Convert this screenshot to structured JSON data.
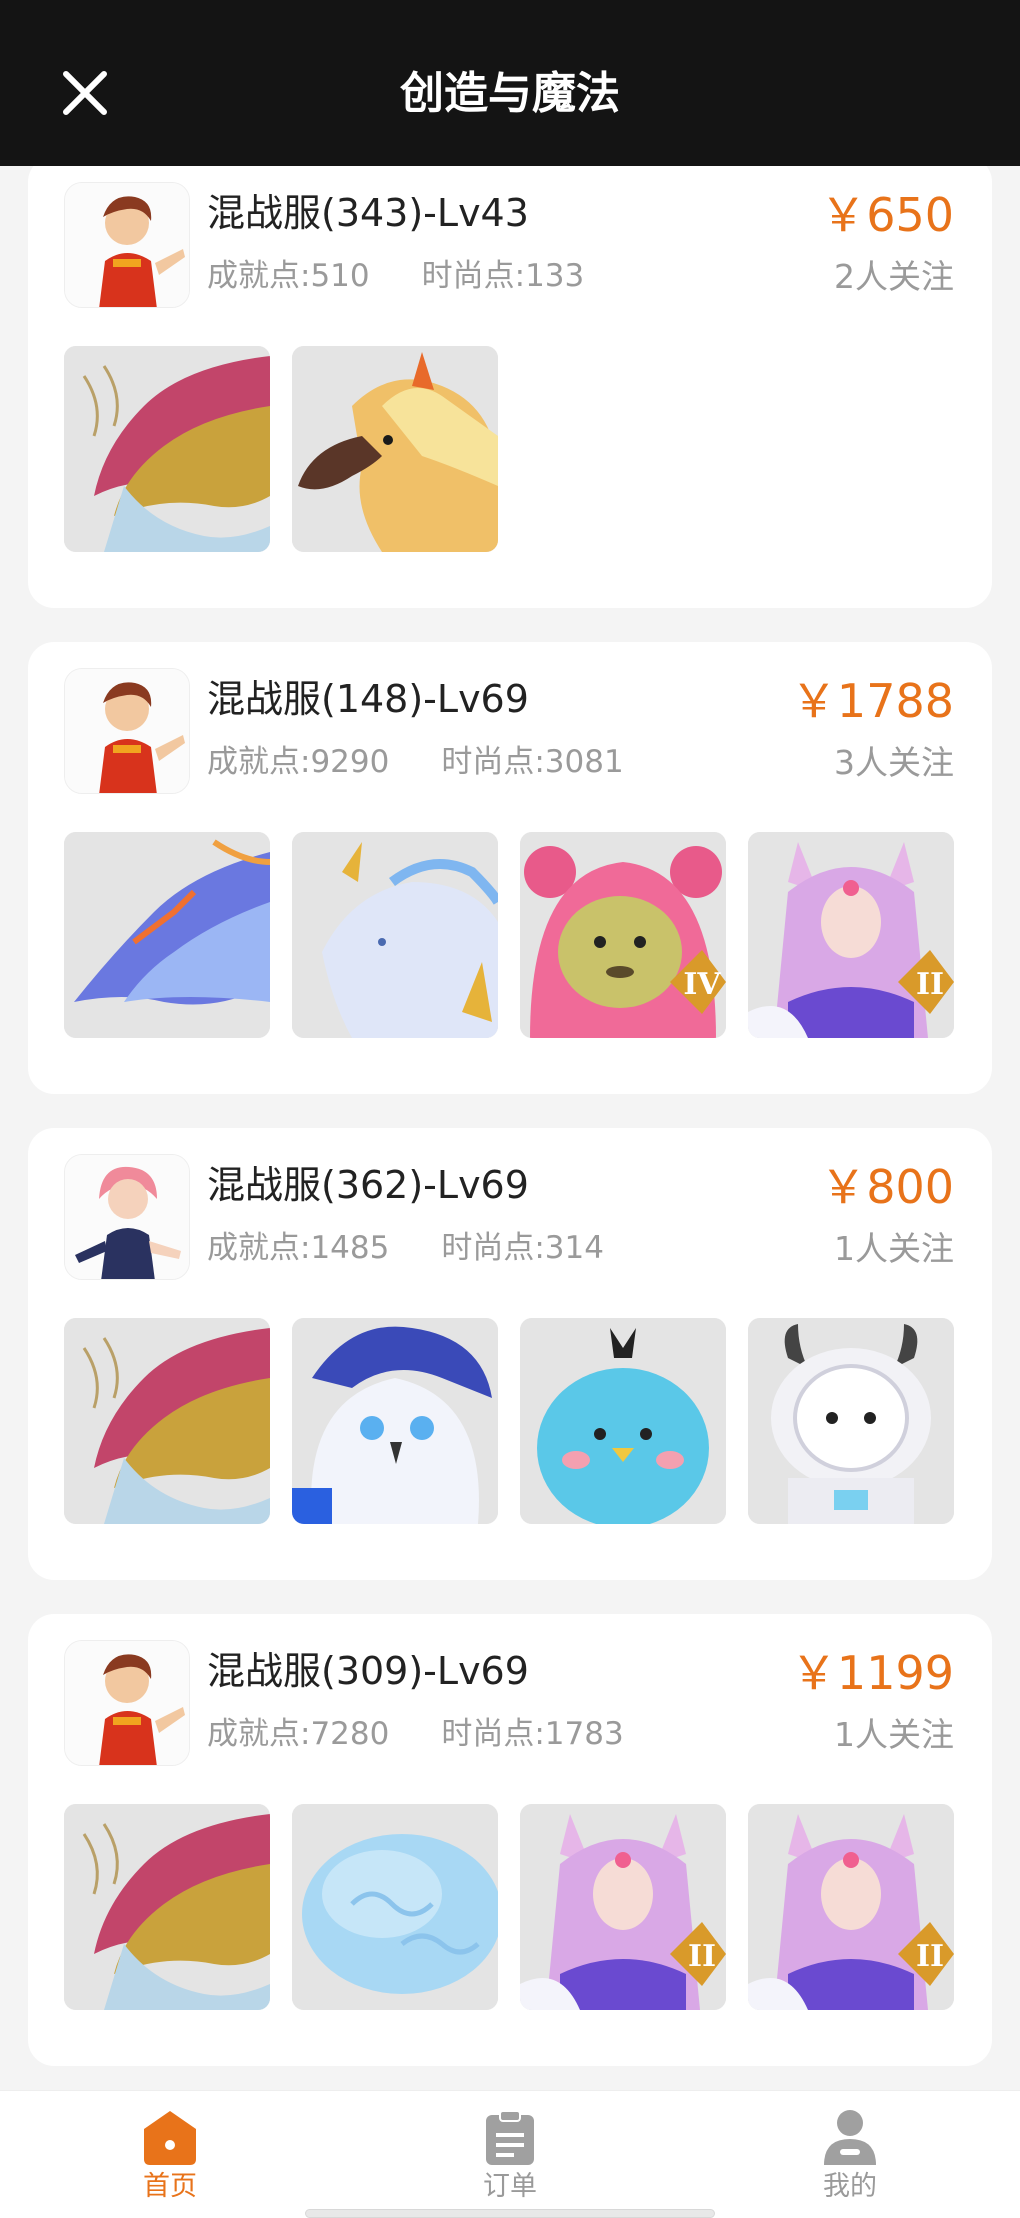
{
  "header": {
    "title": "创造与魔法"
  },
  "listings": [
    {
      "name": "混战服(343)-Lv43",
      "achievement": "成就点:510",
      "fashion": "时尚点:133",
      "price": "￥650",
      "followers": "2人关注",
      "avatar": "boy-red-avatar",
      "thumbs": [
        "red-dragon-mount",
        "golden-phoenix-mount"
      ]
    },
    {
      "name": "混战服(148)-Lv69",
      "achievement": "成就点:9290",
      "fashion": "时尚点:3081",
      "price": "￥1788",
      "followers": "3人关注",
      "avatar": "boy-red-avatar",
      "thumbs": [
        "blue-dragon-mount",
        "ice-qilin-mount",
        "pink-bear-pet-iv",
        "fox-fairy-ii"
      ]
    },
    {
      "name": "混战服(362)-Lv69",
      "achievement": "成就点:1485",
      "fashion": "时尚点:314",
      "price": "￥800",
      "followers": "1人关注",
      "avatar": "girl-pink-avatar",
      "thumbs": [
        "red-dragon-mount",
        "snow-owl-mount",
        "blue-chick-pet",
        "space-cow-pet"
      ]
    },
    {
      "name": "混战服(309)-Lv69",
      "achievement": "成就点:7280",
      "fashion": "时尚点:1783",
      "price": "￥1199",
      "followers": "1人关注",
      "avatar": "boy-red-avatar",
      "thumbs": [
        "red-dragon-mount",
        "cloud-mount",
        "fox-fairy-ii",
        "fox-fairy-ii"
      ]
    }
  ],
  "tabs": [
    {
      "label": "首页",
      "icon": "home-icon",
      "active": true
    },
    {
      "label": "订单",
      "icon": "order-icon",
      "active": false
    },
    {
      "label": "我的",
      "icon": "profile-icon",
      "active": false
    }
  ],
  "colors": {
    "accent": "#e8731a",
    "header_bg": "#141414",
    "muted_text": "#9a9a9a",
    "tab_inactive": "#9a9a9a"
  }
}
